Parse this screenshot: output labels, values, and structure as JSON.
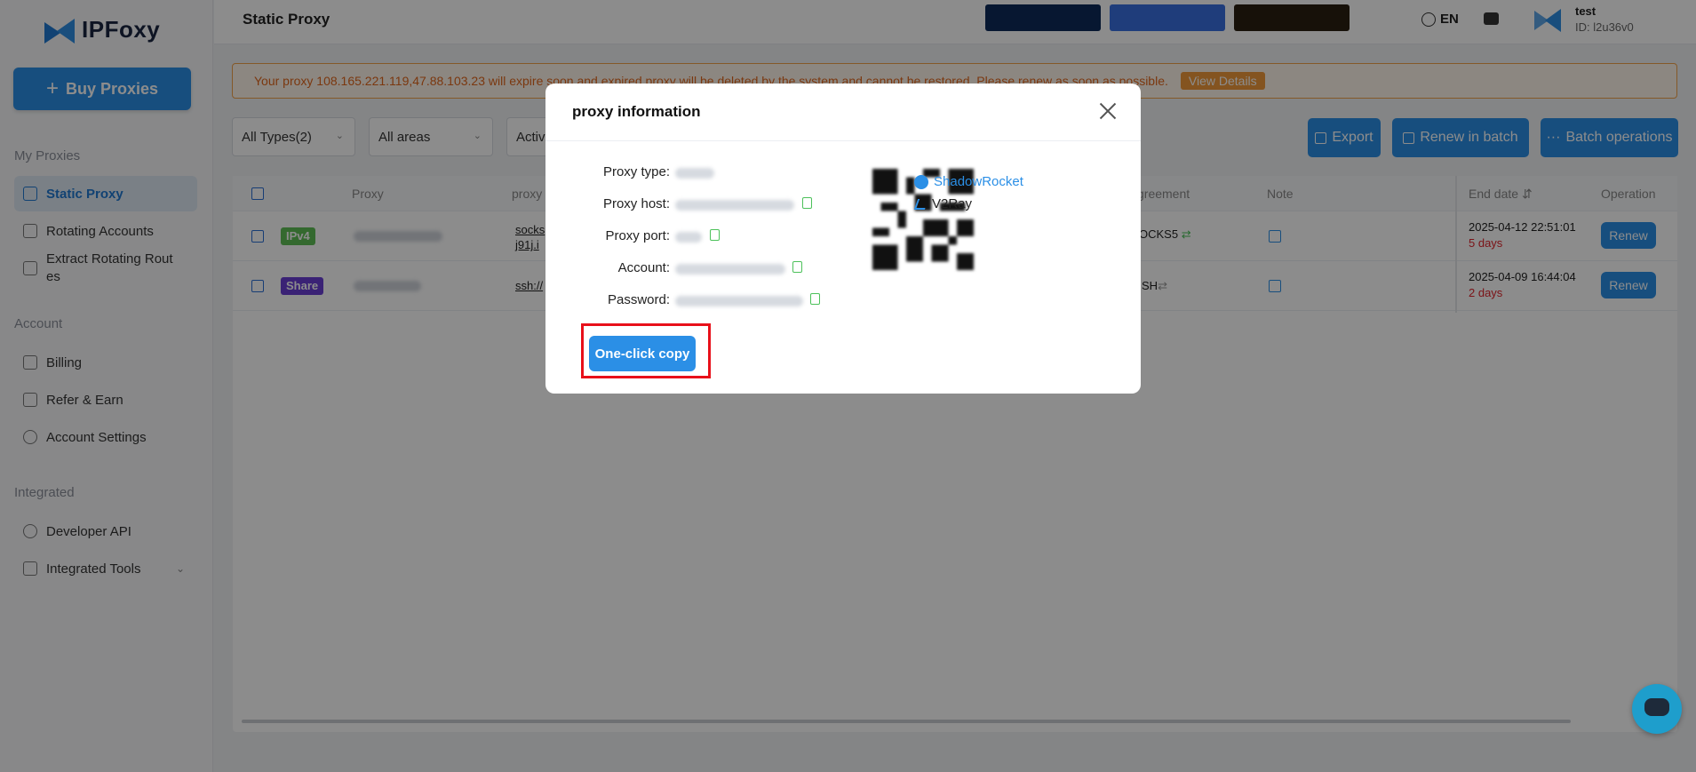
{
  "app": {
    "brand": "IPFoxy",
    "buy_label": "Buy Proxies"
  },
  "sidebar": {
    "sections": [
      {
        "title": "My Proxies"
      },
      {
        "title": "Account"
      },
      {
        "title": "Integrated"
      }
    ],
    "items": [
      {
        "label": "Static Proxy",
        "icon": "static-proxy-icon",
        "active": true
      },
      {
        "label": "Rotating Accounts",
        "icon": "rotating-accounts-icon"
      },
      {
        "label": "Extract Rotating Rout",
        "label2": "es",
        "icon": "extract-rotating-icon"
      },
      {
        "label": "Billing",
        "icon": "billing-icon"
      },
      {
        "label": "Refer & Earn",
        "icon": "refer-icon"
      },
      {
        "label": "Account Settings",
        "icon": "account-settings-icon"
      },
      {
        "label": "Developer API",
        "icon": "developer-api-icon"
      },
      {
        "label": "Integrated Tools",
        "icon": "integrated-tools-icon"
      }
    ]
  },
  "header": {
    "title": "Static Proxy",
    "language": "EN",
    "user_name": "test",
    "user_id": "ID: l2u36v0"
  },
  "warning": {
    "text": "Your proxy 108.165.221.119,47.88.103.23 will expire soon and expired proxy will be deleted by the system and cannot be restored. Please renew as soon as possible.",
    "button": "View Details"
  },
  "filters": {
    "type": "All Types(2)",
    "area": "All areas",
    "status": "Activ"
  },
  "actions": {
    "export": "Export",
    "renew_batch": "Renew in batch",
    "batch_ops": "Batch operations"
  },
  "table": {
    "headers": {
      "proxy": "Proxy",
      "proxy2": "proxy",
      "agreement": "greement",
      "note": "Note",
      "end_date": "End date",
      "operation": "Operation"
    },
    "rows": [
      {
        "tag": "IPv4",
        "link": "socks",
        "link2": "j91j.i",
        "agreement": "OCKS5",
        "end_date": "2025-04-12 22:51:01",
        "days": "5 days",
        "renew": "Renew"
      },
      {
        "tag": "Share",
        "link": "ssh://",
        "agreement": "SH",
        "end_date": "2025-04-09 16:44:04",
        "days": "2 days",
        "renew": "Renew"
      }
    ]
  },
  "modal": {
    "title": "proxy information",
    "fields": [
      {
        "label": "Proxy type:"
      },
      {
        "label": "Proxy host:"
      },
      {
        "label": "Proxy port:"
      },
      {
        "label": "Account:"
      },
      {
        "label": "Password:"
      }
    ],
    "apps": {
      "shadowrocket": "ShadowRocket",
      "v2ray": "V2Ray"
    },
    "oneclick": "One-click copy"
  },
  "colors": {
    "accent": "#2b8fe6",
    "warning": "#e0661c",
    "danger": "#e0242c",
    "highlight": "#e8101a"
  }
}
